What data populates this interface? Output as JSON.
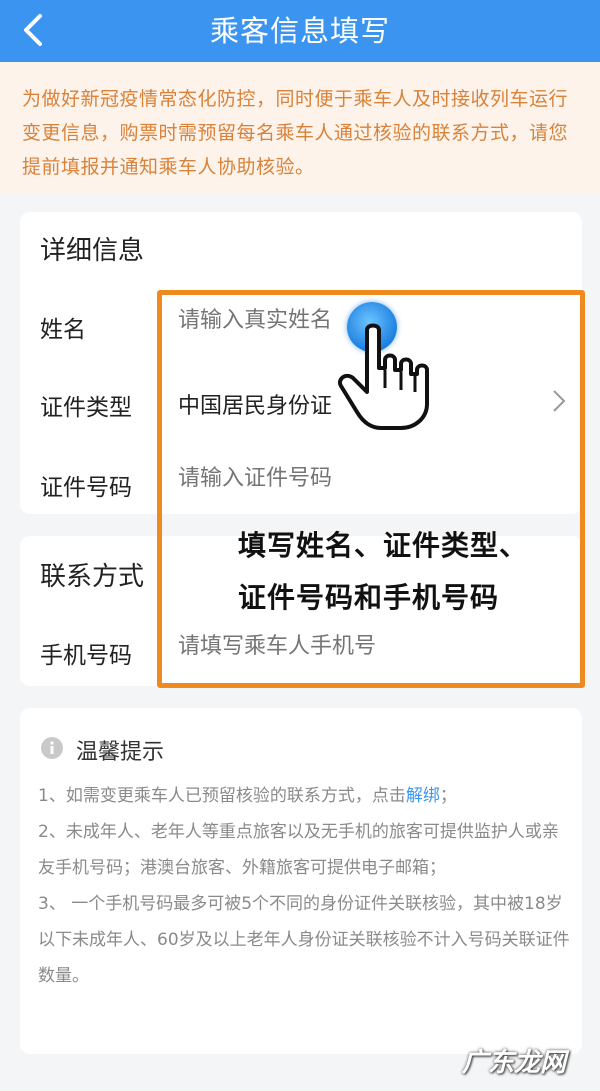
{
  "header": {
    "title": "乘客信息填写"
  },
  "notice": {
    "text": "为做好新冠疫情常态化防控，同时便于乘车人及时接收列车运行变更信息，购票时需预留每名乘车人通过核验的联系方式，请您提前填报并通知乘车人协助核验。"
  },
  "detail": {
    "title": "详细信息",
    "name_label": "姓名",
    "name_placeholder": "请输入真实姓名",
    "id_type_label": "证件类型",
    "id_type_value": "中国居民身份证",
    "id_number_label": "证件号码",
    "id_number_placeholder": "请输入证件号码"
  },
  "contact": {
    "title": "联系方式",
    "phone_label": "手机号码",
    "phone_placeholder": "请填写乘车人手机号"
  },
  "tips": {
    "title": "温馨提示",
    "item1_prefix": "1、如需变更乘车人已预留核验的联系方式，点击",
    "item1_link": "解绑",
    "item1_suffix": "；",
    "item2": "2、未成年人、老年人等重点旅客以及无手机的旅客可提供监护人或亲友手机号码；港澳台旅客、外籍旅客可提供电子邮箱；",
    "item3": "3、 一个手机号码最多可被5个不同的身份证件关联核验，其中被18岁以下未成年人、60岁及以上老年人身份证关联核验不计入号码关联证件数量。"
  },
  "annotation": {
    "line1": "填写姓名、证件类型、",
    "line2": "证件号码和手机号码"
  },
  "watermark": "广东龙网",
  "colors": {
    "header": "#3b95f0",
    "notice_text": "#d9823a",
    "highlight": "#ef8b1e",
    "link": "#3b95f0"
  }
}
